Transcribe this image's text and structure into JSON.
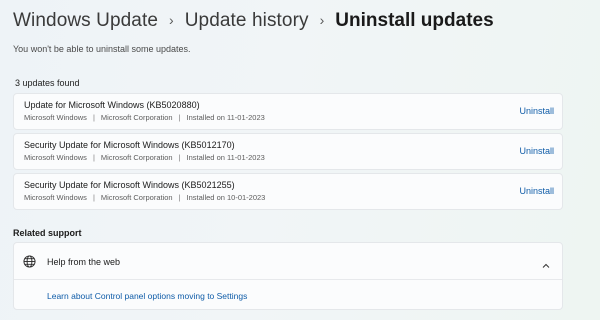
{
  "breadcrumb": {
    "items": [
      "Windows Update",
      "Update history"
    ],
    "separator": "›",
    "current": "Uninstall updates"
  },
  "subtitle": "You won't be able to uninstall some updates.",
  "updates": {
    "count_label": "3 updates found",
    "items": [
      {
        "title": "Update for Microsoft Windows (KB5020880)",
        "product": "Microsoft Windows",
        "publisher": "Microsoft Corporation",
        "installed": "Installed on 11-01-2023",
        "action": "Uninstall"
      },
      {
        "title": "Security Update for Microsoft Windows (KB5012170)",
        "product": "Microsoft Windows",
        "publisher": "Microsoft Corporation",
        "installed": "Installed on 11-01-2023",
        "action": "Uninstall"
      },
      {
        "title": "Security Update for Microsoft Windows (KB5021255)",
        "product": "Microsoft Windows",
        "publisher": "Microsoft Corporation",
        "installed": "Installed on 10-01-2023",
        "action": "Uninstall"
      }
    ]
  },
  "related_support": {
    "label": "Related support",
    "help": {
      "label": "Help from the web",
      "icon": "globe-icon",
      "expanded_icon": "chevron-up-icon",
      "link": "Learn about Control panel options moving to Settings"
    }
  },
  "colors": {
    "accent_link": "#0f5ca8",
    "card_background": "#fbfcfd",
    "card_border": "#e4e7ea"
  }
}
